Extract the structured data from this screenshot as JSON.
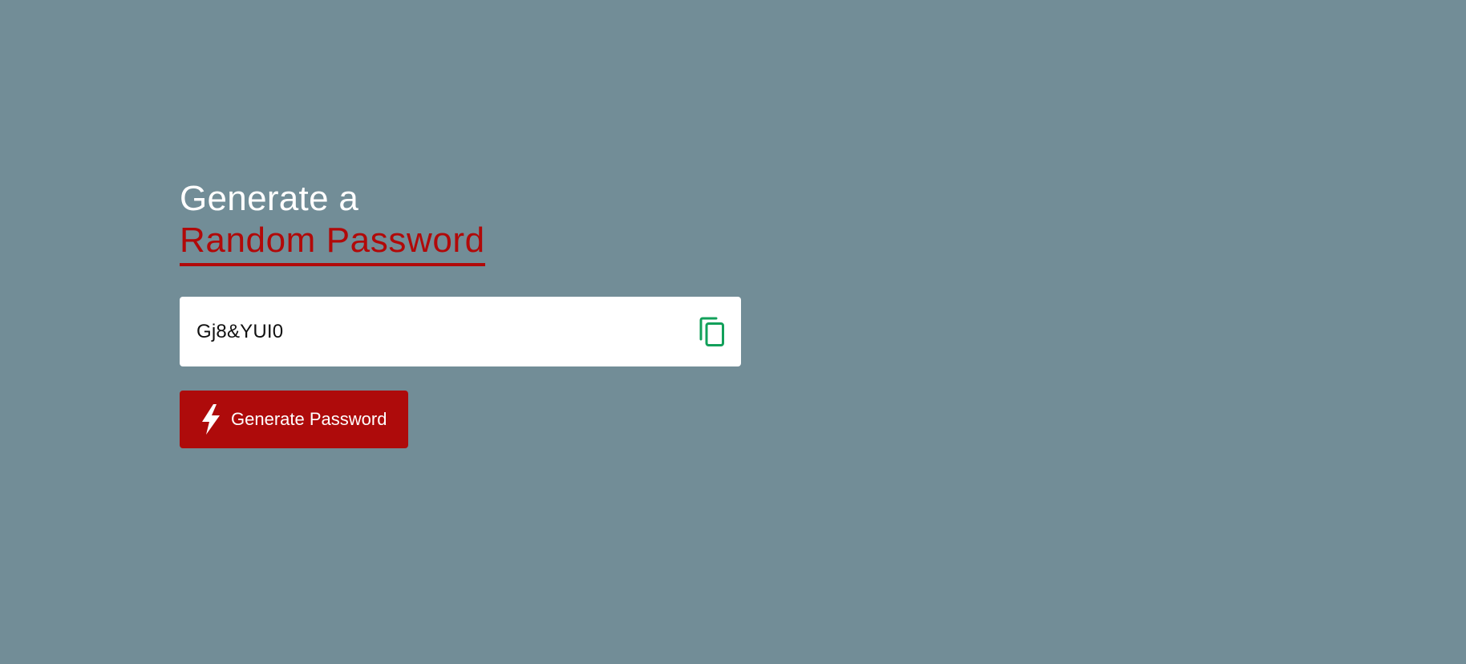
{
  "heading": {
    "line1": "Generate a",
    "line2": "Random Password"
  },
  "password": {
    "value": "Gj8&YUI0",
    "copy_icon": "copy-icon"
  },
  "generate_button": {
    "label": "Generate Password",
    "icon": "lightning-bolt-icon"
  },
  "colors": {
    "background": "#728d97",
    "accent": "#b10909",
    "button": "#ae0b0b",
    "copy_icon": "#12a05a",
    "field_background": "#ffffff",
    "heading_text": "#ffffff"
  }
}
